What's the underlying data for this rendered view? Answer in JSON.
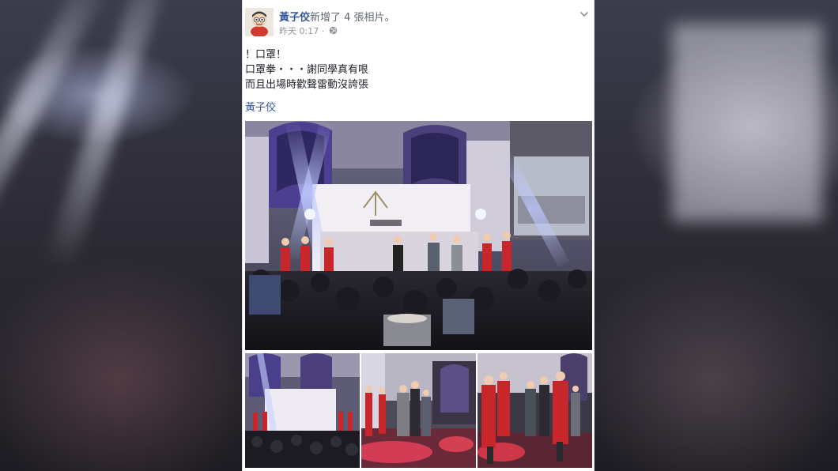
{
  "post": {
    "author": "黃子佼",
    "action": "新增了 4 張相片。",
    "timestamp": "昨天 0:17",
    "separator": "·",
    "privacy_icon": "globe-icon",
    "menu_icon": "chevron-down-icon",
    "text_lines": [
      "！口罩！",
      "口罩拳・・・謝同學真有哏",
      "而且出場時歡聲雷動沒誇張"
    ],
    "tag": "黃子佼"
  },
  "photos": [
    {
      "kind": "stage-wide"
    },
    {
      "kind": "stage-small"
    },
    {
      "kind": "dancers-center"
    },
    {
      "kind": "dancers-red"
    }
  ],
  "colors": {
    "link": "#365899",
    "text": "#1d2129",
    "meta": "#90949c",
    "card_bg": "#ffffff",
    "stage_purple": "#5a4fa8",
    "dancer_red": "#c8262a"
  }
}
